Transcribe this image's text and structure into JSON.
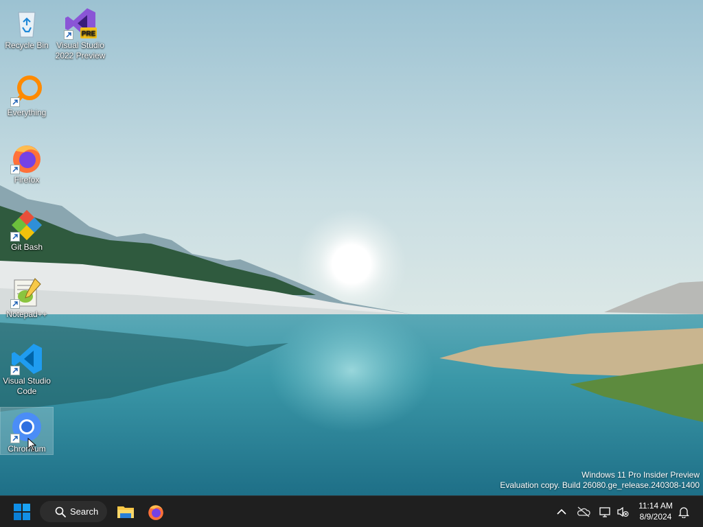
{
  "desktop": {
    "icons": [
      {
        "label": "Recycle Bin",
        "icon": "recycle-bin-icon",
        "shortcut": false
      },
      {
        "label": "Visual Studio 2022 Preview",
        "icon": "visual-studio-preview-icon",
        "shortcut": true,
        "badge": "PRE"
      },
      {
        "label": "Everything",
        "icon": "everything-search-icon",
        "shortcut": true
      },
      {
        "label": "Firefox",
        "icon": "firefox-icon",
        "shortcut": true
      },
      {
        "label": "Git Bash",
        "icon": "git-bash-icon",
        "shortcut": true
      },
      {
        "label": "Notepad++",
        "icon": "notepad-plus-plus-icon",
        "shortcut": true
      },
      {
        "label": "Visual Studio Code",
        "icon": "vscode-icon",
        "shortcut": true
      },
      {
        "label": "Chromium",
        "icon": "chromium-icon",
        "shortcut": true,
        "selected": true
      }
    ]
  },
  "watermark": {
    "line1": "Windows 11 Pro Insider Preview",
    "line2": "Evaluation copy. Build 26080.ge_release.240308-1400"
  },
  "taskbar": {
    "start_icon": "windows-start-icon",
    "search_label": "Search",
    "pinned": [
      {
        "name": "file-explorer-icon"
      },
      {
        "name": "firefox-icon"
      }
    ],
    "tray": {
      "icons": [
        "chevron-up-icon",
        "onedrive-offline-icon",
        "network-icon",
        "volume-muted-icon",
        "notifications-icon"
      ]
    },
    "clock": {
      "time": "11:14 AM",
      "date": "8/9/2024"
    }
  },
  "colors": {
    "taskbar_bg": "#1f1f1f",
    "windows_blue": "#0f8fe8",
    "sky_top": "#a4c9d7",
    "water": "#2d8ea0"
  }
}
